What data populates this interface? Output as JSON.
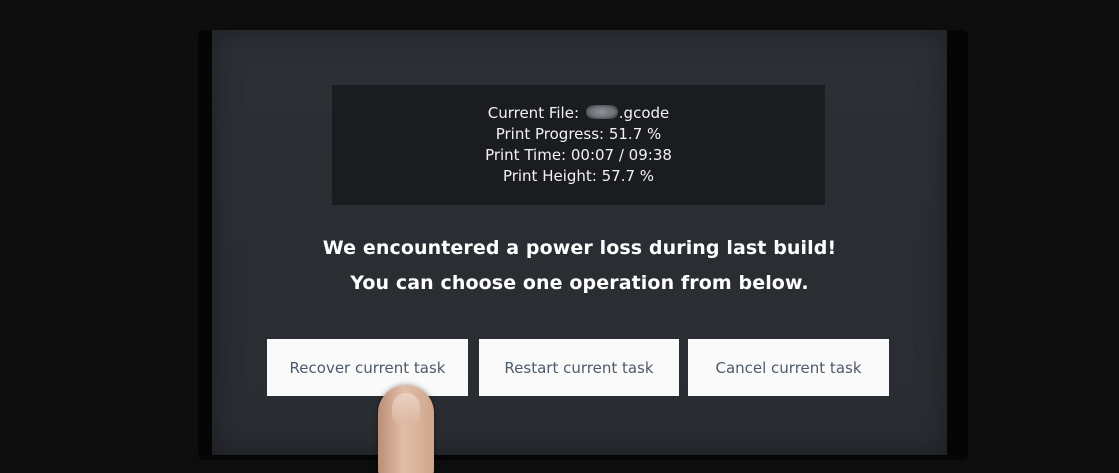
{
  "status": {
    "file_label": "Current File:",
    "file_suffix": ".gcode",
    "progress_line": "Print Progress: 51.7 %",
    "time_line": "Print Time: 00:07 / 09:38",
    "height_line": "Print Height: 57.7 %"
  },
  "message": {
    "line1": "We encountered a power loss during last build!",
    "line2": "You can choose one operation from below."
  },
  "actions": {
    "recover_label": "Recover current task",
    "restart_label": "Restart current task",
    "cancel_label": "Cancel current task"
  },
  "colors": {
    "screen_bg": "#2b2f34",
    "info_box_bg": "#1b1c1f",
    "button_bg": "#fafafa",
    "button_text": "#4e5a6a"
  }
}
